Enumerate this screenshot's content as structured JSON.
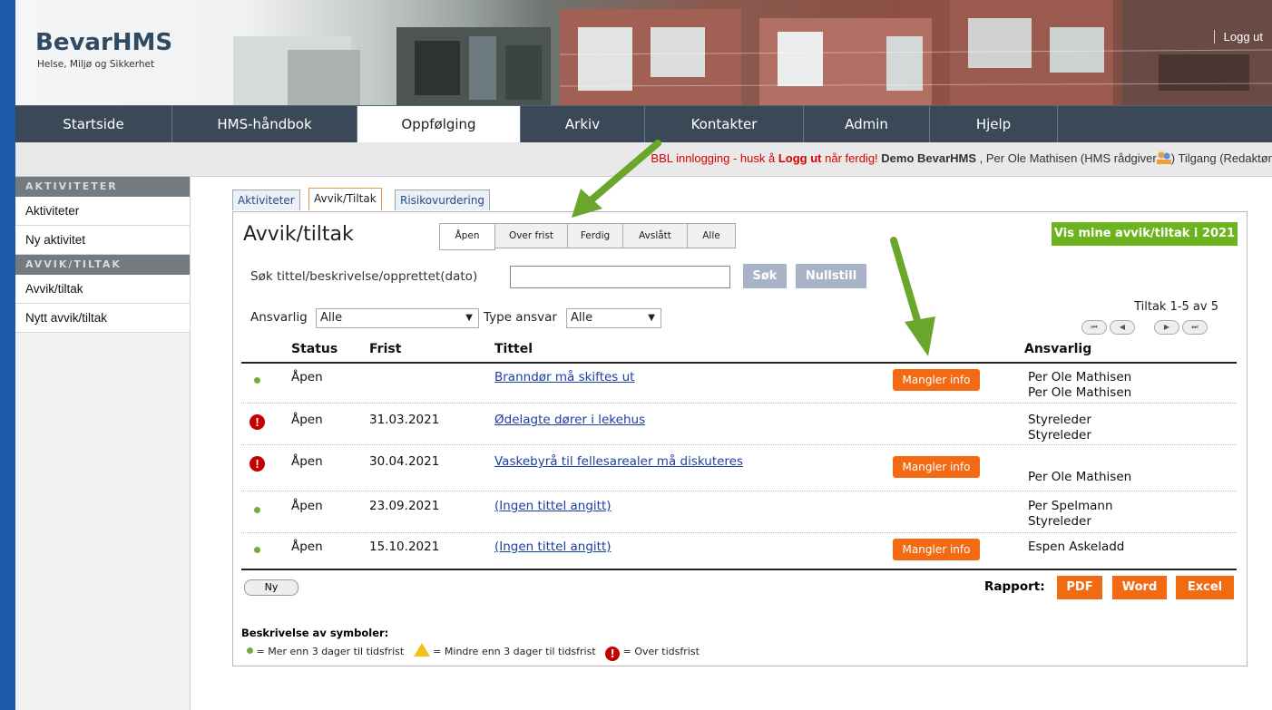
{
  "header": {
    "logo_title": "BevarHMS",
    "logo_subtitle": "Helse, Miljø og Sikkerhet",
    "logout": "Logg ut"
  },
  "nav": {
    "items": [
      "Startside",
      "HMS-håndbok",
      "Oppfølging",
      "Arkiv",
      "Kontakter",
      "Admin",
      "Hjelp"
    ],
    "active": "Oppfølging"
  },
  "infobar": {
    "part1": "BBL innlogging - husk å ",
    "part2": "Logg ut",
    "part3": " når ferdig! ",
    "org": "Demo BevarHMS",
    "user": " , Per Ole Mathisen (HMS rådgiver",
    "access": ") Tilgang (Redaktør"
  },
  "sidebar": {
    "section1": "AKTIVITETER",
    "items1": [
      "Aktiviteter",
      "Ny aktivitet"
    ],
    "section2": "AVVIK/TILTAK",
    "items2": [
      "Avvik/tiltak",
      "Nytt avvik/tiltak"
    ]
  },
  "tabs": [
    "Aktiviteter",
    "Avvik/Tiltak",
    "Risikovurdering"
  ],
  "panel": {
    "title": "Avvik/tiltak",
    "filters": [
      "Åpen",
      "Over frist",
      "Ferdig",
      "Avslått",
      "Alle"
    ],
    "show_mine": "Vis mine avvik/tiltak i 2021",
    "search_label": "Søk tittel/beskrivelse/opprettet(dato)",
    "search_value": "",
    "search_btn": "Søk",
    "reset_btn": "Nullstill",
    "ansvarlig_label": "Ansvarlig",
    "ansvarlig_value": "Alle",
    "type_label": "Type ansvar",
    "type_value": "Alle",
    "paging": "Tiltak 1-5 av 5",
    "paging_buttons": [
      "⏮",
      "◀",
      "▶",
      "⏭"
    ]
  },
  "table": {
    "headers": {
      "status": "Status",
      "frist": "Frist",
      "tittel": "Tittel",
      "ansvarlig": "Ansvarlig"
    },
    "rows": [
      {
        "icon": "green",
        "status": "Åpen",
        "frist": "",
        "tittel": "Branndør må skiftes ut",
        "mangler": "Mangler info",
        "ansvarlig": [
          "Per Ole Mathisen",
          "Per Ole Mathisen"
        ]
      },
      {
        "icon": "red",
        "status": "Åpen",
        "frist": "31.03.2021",
        "tittel": "Ødelagte dører i lekehus",
        "mangler": "",
        "ansvarlig": [
          "Styreleder",
          "Styreleder"
        ]
      },
      {
        "icon": "red",
        "status": "Åpen",
        "frist": "30.04.2021",
        "tittel": "Vaskebyrå til fellesarealer må diskuteres",
        "mangler": "Mangler info",
        "ansvarlig": [
          "",
          "Per Ole Mathisen"
        ]
      },
      {
        "icon": "green",
        "status": "Åpen",
        "frist": "23.09.2021",
        "tittel": "(Ingen tittel angitt)",
        "mangler": "",
        "ansvarlig": [
          "Per Spelmann",
          "Styreleder"
        ]
      },
      {
        "icon": "green",
        "status": "Åpen",
        "frist": "15.10.2021",
        "tittel": "(Ingen tittel angitt)",
        "mangler": "Mangler info",
        "ansvarlig": [
          "Espen Askeladd",
          ""
        ]
      }
    ]
  },
  "footer": {
    "ny": "Ny",
    "rapport": "Rapport:",
    "pdf": "PDF",
    "word": "Word",
    "excel": "Excel",
    "legend_title": "Beskrivelse av symboler:",
    "legend_green": " = Mer enn 3 dager til tidsfrist",
    "legend_warn": " = Mindre enn 3 dager til tidsfrist",
    "legend_red": " = Over tidsfrist"
  },
  "colors": {
    "accent_green": "#6cb41e",
    "orange": "#f26b12",
    "nav": "#3b4858",
    "arrow": "#6aa52c"
  }
}
